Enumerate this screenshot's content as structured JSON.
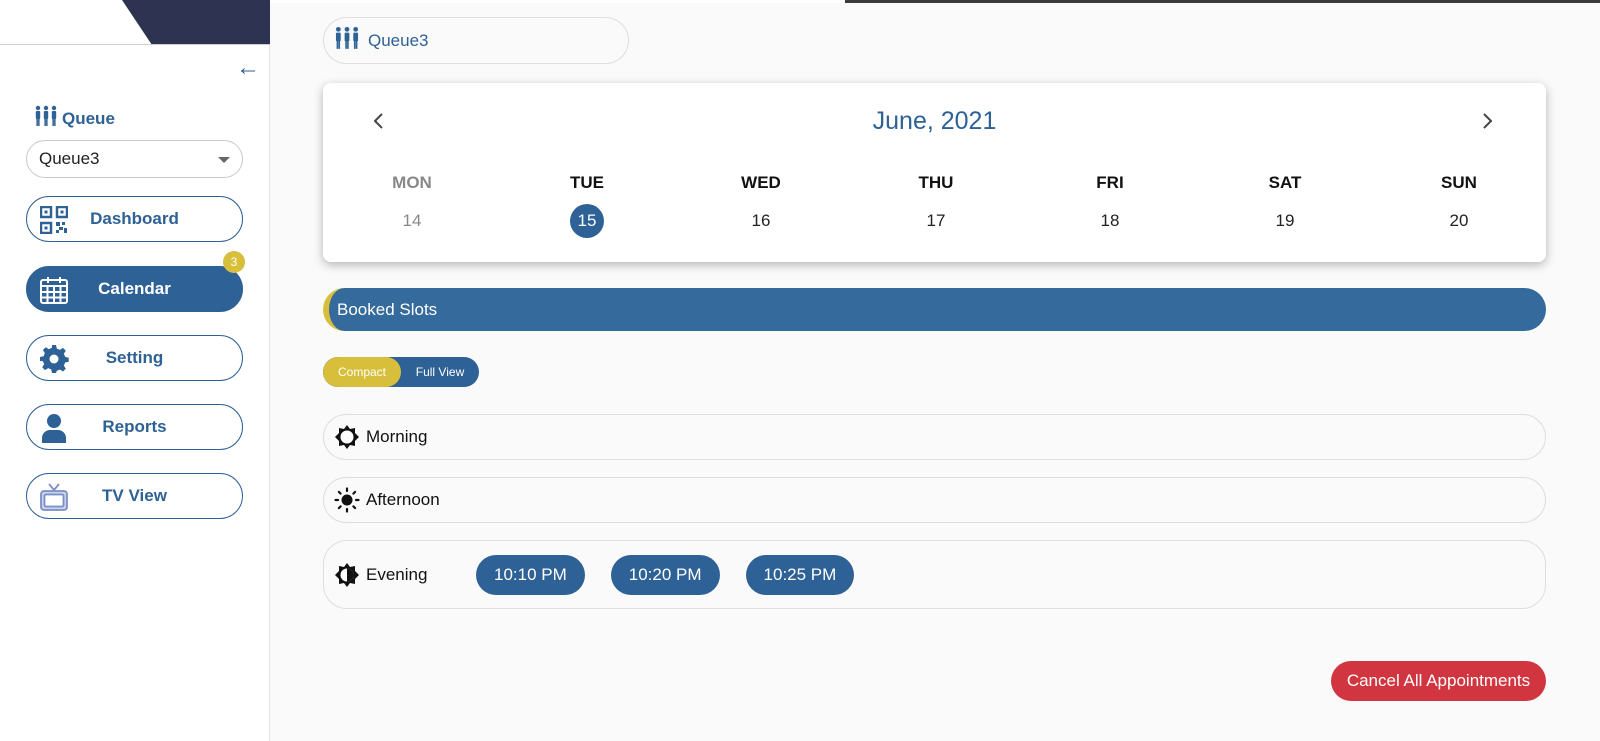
{
  "sidebar": {
    "queue_label": "Queue",
    "queue_select_value": "Queue3",
    "nav": [
      {
        "label": "Dashboard",
        "icon": "qr-code-icon",
        "active": false
      },
      {
        "label": "Calendar",
        "icon": "calendar-icon",
        "active": true,
        "badge": "3"
      },
      {
        "label": "Setting",
        "icon": "gear-icon",
        "active": false
      },
      {
        "label": "Reports",
        "icon": "user-icon",
        "active": false
      },
      {
        "label": "TV View",
        "icon": "tv-icon",
        "active": false
      }
    ]
  },
  "main": {
    "queue_pill_label": "Queue3",
    "calendar": {
      "title": "June, 2021",
      "days": [
        {
          "name": "MON",
          "date": "14",
          "muted": true
        },
        {
          "name": "TUE",
          "date": "15",
          "selected": true
        },
        {
          "name": "WED",
          "date": "16"
        },
        {
          "name": "THU",
          "date": "17"
        },
        {
          "name": "FRI",
          "date": "18"
        },
        {
          "name": "SAT",
          "date": "19"
        },
        {
          "name": "SUN",
          "date": "20"
        }
      ]
    },
    "booked_slots_label": "Booked Slots",
    "view_toggle": {
      "compact": "Compact",
      "full": "Full View"
    },
    "periods": {
      "morning": "Morning",
      "afternoon": "Afternoon",
      "evening": "Evening"
    },
    "evening_slots": [
      "10:10 PM",
      "10:20 PM",
      "10:25 PM"
    ],
    "cancel_all_label": "Cancel All Appointments"
  },
  "colors": {
    "primary": "#2e6195",
    "accent": "#d7bf3b",
    "danger": "#d1353f",
    "brand_dark": "#2f3352"
  }
}
